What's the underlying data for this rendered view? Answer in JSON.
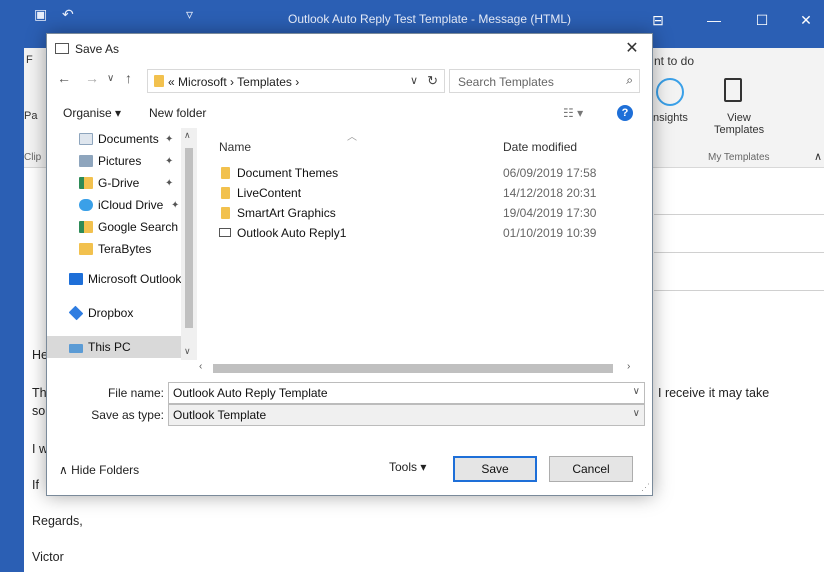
{
  "outlook": {
    "title": "Outlook Auto Reply Test Template  -  Message (HTML)",
    "ribbon": {
      "tab_fragment": "F",
      "paste_fragment": "Pa",
      "clipboard_fragment": "Clip",
      "want_to_do": "nt to do",
      "insights_label": "Insights",
      "view_templates_label": "View\nTemplates",
      "my_templates_group": "My Templates"
    },
    "body_fragments": [
      "He",
      "Th",
      "so",
      "I w",
      "If"
    ],
    "body_line_tail": "I receive it may take",
    "regards": "Regards,",
    "signature": "Victor"
  },
  "dialog": {
    "title": "Save As",
    "address": {
      "prefix": "«",
      "crumbs": [
        "Microsoft",
        "Templates"
      ]
    },
    "search_placeholder": "Search Templates",
    "organise_label": "Organise",
    "new_folder_label": "New folder",
    "nav_items": [
      {
        "label": "Documents",
        "icon": "documents-icon",
        "pinned": true
      },
      {
        "label": "Pictures",
        "icon": "pictures-icon",
        "pinned": true
      },
      {
        "label": "G-Drive",
        "icon": "drive-folder-icon",
        "pinned": true
      },
      {
        "label": "iCloud Drive",
        "icon": "icloud-icon",
        "pinned": true
      },
      {
        "label": "Google Search C",
        "icon": "drive-folder-icon",
        "pinned": false
      },
      {
        "label": "TeraBytes",
        "icon": "folder-icon",
        "pinned": false
      },
      {
        "label": "Microsoft Outlook",
        "icon": "outlook-icon",
        "pinned": false
      },
      {
        "label": "Dropbox",
        "icon": "dropbox-icon",
        "pinned": false
      },
      {
        "label": "This PC",
        "icon": "pc-icon",
        "pinned": false
      }
    ],
    "columns": {
      "name": "Name",
      "date": "Date modified"
    },
    "files": [
      {
        "name": "Document Themes",
        "date": "06/09/2019 17:58",
        "icon": "folder-icon"
      },
      {
        "name": "LiveContent",
        "date": "14/12/2018 20:31",
        "icon": "folder-icon"
      },
      {
        "name": "SmartArt Graphics",
        "date": "19/04/2019 17:30",
        "icon": "folder-icon"
      },
      {
        "name": "Outlook Auto Reply1",
        "date": "01/10/2019 10:39",
        "icon": "mail-template-icon"
      }
    ],
    "file_name_label": "File name:",
    "file_name_value": "Outlook Auto Reply Template",
    "save_type_label": "Save as type:",
    "save_type_value": "Outlook Template",
    "hide_folders_label": "Hide Folders",
    "tools_label": "Tools",
    "save_label": "Save",
    "cancel_label": "Cancel",
    "colors": {
      "accent": "#1e6fd8",
      "outlook_blue": "#2b5fb4",
      "folder": "#f2c14e"
    }
  }
}
